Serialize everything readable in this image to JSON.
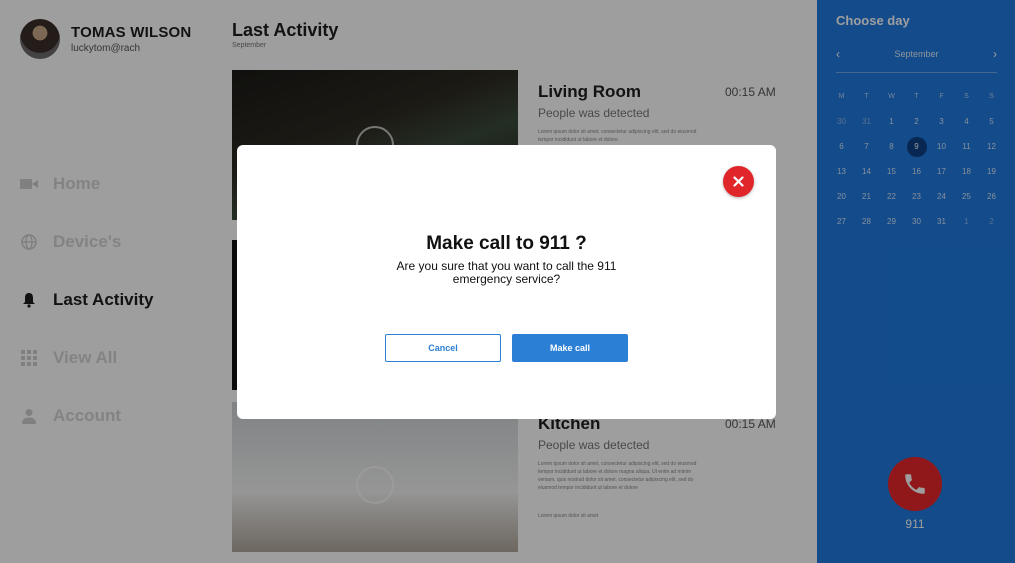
{
  "profile": {
    "name": "TOMAS WILSON",
    "email": "luckytom@rach"
  },
  "nav": [
    {
      "label": "Home",
      "icon": "video-camera-icon",
      "active": false
    },
    {
      "label": "Device's",
      "icon": "globe-icon",
      "active": false
    },
    {
      "label": "Last Activity",
      "icon": "bell-icon",
      "active": true
    },
    {
      "label": "View All",
      "icon": "grid-icon",
      "active": false
    },
    {
      "label": "Account",
      "icon": "user-icon",
      "active": false
    }
  ],
  "main": {
    "title": "Last Activity",
    "subtitle": "September",
    "cards": [
      {
        "title": "Living Room",
        "time": "00:15 AM",
        "desc": "People was detected",
        "lorem": "Lorem ipsum dolor sit amet, consectetur adipiscing elit, sed do eiusmod tempor incididunt ut labore et dolore"
      },
      {
        "title": "Kitchen",
        "time": "00:15 AM",
        "desc": "People was detected",
        "lorem": "Lorem ipsum dolor sit amet, consectetur adipiscing elit, sed do eiusmod tempor incididunt ut labore et dolore magna aliqua. Ut enim ad minim veniam, quis nostrud dolor sit amet, consectetur adipiscing elit, sed do eiusmod tempor incididunt ut labore et dolore"
      }
    ],
    "card_footer": "Lorem ipsum dolor sit amet"
  },
  "calendar": {
    "title": "Choose day",
    "month": "September",
    "weekdays": [
      "M",
      "T",
      "W",
      "T",
      "F",
      "S",
      "S"
    ],
    "days": [
      [
        "30",
        "31",
        "1",
        "2",
        "3",
        "4",
        "5"
      ],
      [
        "6",
        "7",
        "8",
        "9",
        "10",
        "11",
        "12"
      ],
      [
        "13",
        "14",
        "15",
        "16",
        "17",
        "18",
        "19"
      ],
      [
        "20",
        "21",
        "22",
        "23",
        "24",
        "25",
        "26"
      ],
      [
        "27",
        "28",
        "29",
        "30",
        "31",
        "1",
        "2"
      ]
    ],
    "selected_day": "9",
    "call_label": "911"
  },
  "modal": {
    "title": "Make call to 911 ?",
    "text": "Are you sure that you want to call the 911 emergency service?",
    "cancel_label": "Cancel",
    "confirm_label": "Make call"
  },
  "colors": {
    "accent": "#2b7fd4",
    "calendar_bg": "#1f7ae0",
    "danger": "#e0262a"
  }
}
